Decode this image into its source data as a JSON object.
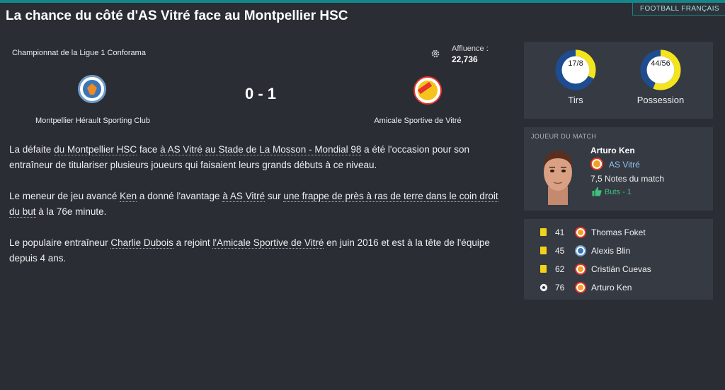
{
  "header": {
    "section_tag": "FOOTBALL FRANÇAIS",
    "title": "La chance du côté d'AS Vitré face au Montpellier HSC"
  },
  "match": {
    "competition": "Championnat de la Ligue 1 Conforama",
    "attendance_label": "Affluence :",
    "attendance_value": "22,736",
    "score": "0 - 1",
    "home_team": "Montpellier Hérault Sporting Club",
    "away_team": "Amicale Sportive de Vitré",
    "settings_icon": "gear-icon",
    "home_crest_colors": [
      "#3c76b6",
      "#f08a22"
    ],
    "away_crest_colors": [
      "#e8352c",
      "#f4c41c"
    ]
  },
  "article": {
    "p1": {
      "t1": "La défaite ",
      "l1": "du Montpellier HSC",
      "t2": " face ",
      "l2": "à AS Vitré",
      "t3": " ",
      "l3": "au Stade de La Mosson - Mondial 98",
      "t4": " a été l'occasion pour son entraîneur de titulariser plusieurs joueurs qui faisaient leurs grands débuts à ce niveau."
    },
    "p2": {
      "t1": "Le meneur de jeu avancé ",
      "l1": "Ken",
      "t2": " a donné l'avantage ",
      "l2": "à AS Vitré",
      "t3": " sur ",
      "l3": "une frappe de près à ras de terre dans le coin droit du but",
      "t4": " à la 76e minute."
    },
    "p3": {
      "t1": "Le populaire entraîneur ",
      "l1": "Charlie Dubois",
      "t2": " a rejoint ",
      "l2": "l'Amicale Sportive de Vitré",
      "t3": " en juin 2016 et est à la tête de l'équipe depuis 4 ans."
    }
  },
  "stats": {
    "shots": {
      "value": "17/8",
      "label": "Tirs",
      "home": 17,
      "away": 8
    },
    "possession": {
      "value": "44/56",
      "label": "Possession",
      "home": 44,
      "away": 56
    },
    "home_color": "#1e4c91",
    "away_color": "#f4e41c"
  },
  "motm": {
    "title": "JOUEUR DU MATCH",
    "name": "Arturo Ken",
    "club": "AS Vitré",
    "rating": "7,5",
    "rating_label": "Notes du match",
    "goals_text": "Buts - 1",
    "goals_icon": "thumbs-up-icon",
    "club_link_color": "#8fc6f5"
  },
  "events": [
    {
      "type": "yellow-card",
      "minute": "41",
      "team": "away",
      "player": "Thomas Foket"
    },
    {
      "type": "yellow-card",
      "minute": "45",
      "team": "home",
      "player": "Alexis Blin"
    },
    {
      "type": "yellow-card",
      "minute": "62",
      "team": "away",
      "player": "Cristián Cuevas"
    },
    {
      "type": "goal",
      "minute": "76",
      "team": "away",
      "player": "Arturo Ken"
    }
  ]
}
